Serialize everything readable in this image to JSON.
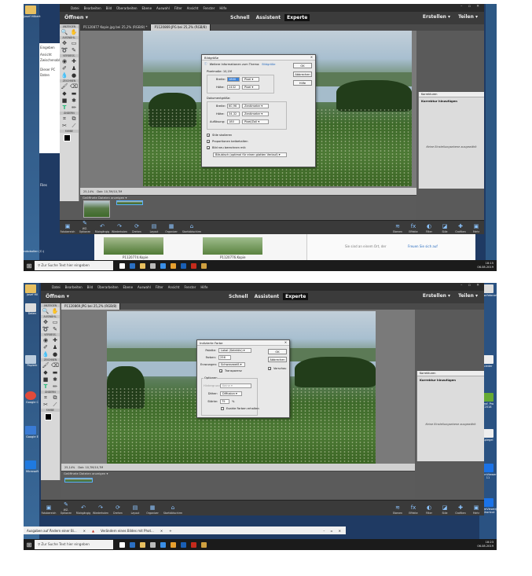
{
  "screenshot1": {
    "menu": [
      "Datei",
      "Bearbeiten",
      "Bild",
      "Überarbeiten",
      "Ebene",
      "Auswahl",
      "Filter",
      "Ansicht",
      "Fenster",
      "Hilfe"
    ],
    "open_label": "Öffnen",
    "modes": [
      "Schnell",
      "Assistent",
      "Experte"
    ],
    "active_mode": "Experte",
    "create_label": "Erstellen",
    "share_label": "Teilen",
    "tabs": [
      "P1120877 Kopie.jpg bei 25,2% (RGB/8) *",
      "P1120869.JPG bei 25,2% (RGB/8)"
    ],
    "desktop_labels": [
      "Josef Hilbert"
    ],
    "tool_sections": [
      "ANZEIGEN",
      "AUSWÄHL.",
      "VERBESS.",
      "ZEICHNEN",
      "ÄNDERN",
      "FARBE"
    ],
    "status": {
      "zoom": "25,14%",
      "doc": "Dok: 10,7M/10,7M"
    },
    "film_dropdown": "Geöffnete Dateien anzeigen",
    "panel": {
      "tab": "Korrekturen",
      "title": "Korrektur hinzufügen",
      "empty": "Keine Einstellungsebene ausgewählt"
    },
    "bottom_buttons": [
      "Fotobereich",
      "WZ-Optionen",
      "Rückgängig",
      "Wiederholen",
      "Drehen",
      "Layout",
      "Organizer",
      "Startbildschirm",
      "Ebenen",
      "Effekte",
      "Filter",
      "Stile",
      "Grafiken",
      "Mehr"
    ],
    "dialog": {
      "title": "Bildgröße",
      "info": "Weitere Informationen zum Thema:",
      "info_link": "Bildgröße",
      "pixel_size": "Pixelmaße: 10,1M",
      "width_label": "Breite:",
      "width_value": "1800",
      "width_unit": "Pixel",
      "height_label": "Höhe:",
      "height_value": "2432",
      "height_unit": "Pixel",
      "doc_size": "Dokumentgröße:",
      "dwidth_value": "60,96",
      "dwidth_unit": "Zentimeter",
      "dheight_value": "34,32",
      "dheight_unit": "Zentimeter",
      "res_label": "Auflösung:",
      "res_value": "180",
      "res_unit": "Pixel/Zoll",
      "cb1": "Stile skalieren",
      "cb2": "Proportionen beibehalten",
      "cb3": "Bild neu berechnen mit:",
      "resample": "Bikubisch (optimal für einen glatten Verlauf)",
      "ok": "OK",
      "cancel": "Abbrechen",
      "help": "Hilfe"
    },
    "explorer_left": [
      "Eingeben",
      "Ansicht",
      "Zwischenablage",
      "Dieser PC",
      "Daten"
    ],
    "explorer_bottom": [
      "P1120774.Kopie",
      "P1120776.Kopie",
      "Kopie"
    ],
    "left_misc": [
      "Files",
      "rotokoller (C:)"
    ],
    "right_misc": [
      "Sie sind an einem Ort, der",
      "Freuen Sie sich auf"
    ],
    "taskbar_search": "Zur Suche Text hier eingeben",
    "clock": {
      "time": "18:15",
      "date": "06.08.2019"
    }
  },
  "screenshot2": {
    "menu": [
      "Datei",
      "Bearbeiten",
      "Bild",
      "Überarbeiten",
      "Ebene",
      "Auswahl",
      "Filter",
      "Ansicht",
      "Fenster",
      "Hilfe"
    ],
    "open_label": "Öffnen",
    "modes": [
      "Schnell",
      "Assistent",
      "Experte"
    ],
    "active_mode": "Experte",
    "create_label": "Erstellen",
    "share_label": "Teilen",
    "tabs": [
      "P1120869.JPG bei 25,2% (RGB/8)"
    ],
    "desktop_labels": [
      "Josef Hil",
      "Daten",
      "Papierk",
      "Google C",
      "Google E",
      "Microsoft"
    ],
    "right_desktop": [
      "www.fotocommunity.de",
      "Lieder",
      "Prof. Pro 2018",
      "Spiegel",
      "TeamViewer 11",
      "TeamViewer(2)10_con - Shortcut"
    ],
    "tool_sections": [
      "ANZEIGEN",
      "AUSWÄHL.",
      "VERBESS.",
      "ZEICHNEN",
      "ÄNDERN",
      "FARBE"
    ],
    "status": {
      "zoom": "25,14%",
      "doc": "Dok: 10,7M/10,7M"
    },
    "film_dropdown": "Geöffnete Dateien anzeigen",
    "panel": {
      "tab": "Korrekturen",
      "title": "Korrektur hinzufügen",
      "empty": "Keine Einstellungsebene ausgewählt"
    },
    "bottom_buttons": [
      "Fotobereich",
      "WZ-Optionen",
      "Rückgängig",
      "Wiederholen",
      "Drehen",
      "Layout",
      "Organizer",
      "Startbildschirm",
      "Ebenen",
      "Effekte",
      "Filter",
      "Stile",
      "Grafiken",
      "Mehr"
    ],
    "dialog": {
      "title": "Indizierte Farbe",
      "palette_label": "Palette:",
      "palette_value": "Lokal (Selektiv)",
      "colors_label": "Farben:",
      "colors_value": "256",
      "forced_label": "Erzwungen:",
      "forced_value": "Schwarzweiß",
      "transparency": "Transparenz",
      "options": "Optionen",
      "matte_label": "Hintergrund:",
      "matte_value": "Keine",
      "dither_label": "Dither:",
      "dither_value": "Diffusion",
      "amount_label": "Stärke:",
      "amount_value": "75",
      "amount_unit": "%",
      "exact": "Exakte Farben erhalten",
      "preview": "Vorschau",
      "ok": "OK",
      "cancel": "Abbrechen"
    },
    "browser_tabs": [
      "Ausgaben auf Ändern einer Bi...",
      "Verändern eines Bildes mit Phot..."
    ],
    "taskbar_search": "Zur Suche Text hier eingeben",
    "clock": {
      "time": "18:23",
      "date": "06.08.2019"
    }
  }
}
